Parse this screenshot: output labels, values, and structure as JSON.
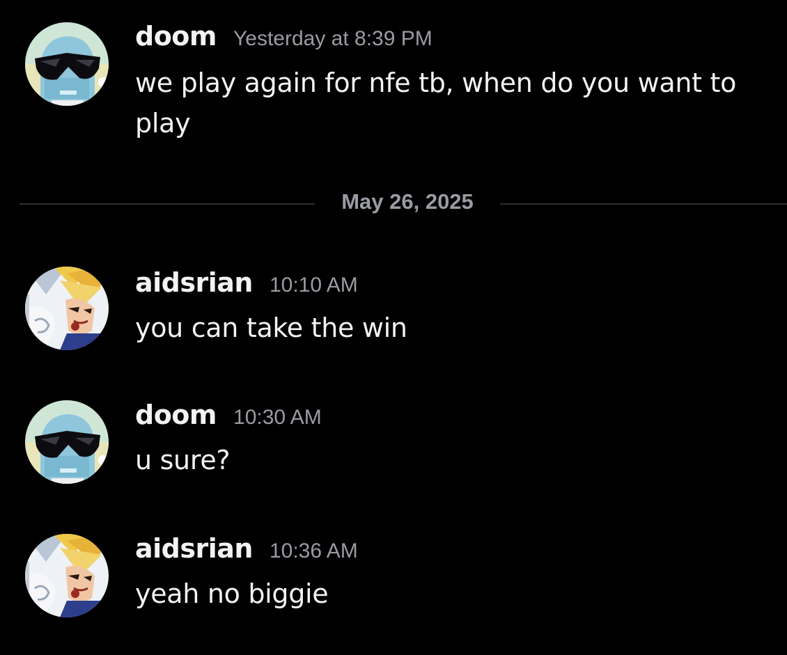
{
  "date_divider": "May 26, 2025",
  "messages": [
    {
      "author": "doom",
      "timestamp": "Yesterday at 8:39 PM",
      "text": "we play again for nfe tb, when do you want to play",
      "avatar": "squirtle-sunglasses-avatar"
    },
    {
      "author": "aidsrian",
      "timestamp": "10:10 AM",
      "text": "you can take the win",
      "avatar": "anime-character-avatar"
    },
    {
      "author": "doom",
      "timestamp": "10:30 AM",
      "text": "u sure?",
      "avatar": "squirtle-sunglasses-avatar"
    },
    {
      "author": "aidsrian",
      "timestamp": "10:36 AM",
      "text": "yeah no biggie",
      "avatar": "anime-character-avatar"
    }
  ],
  "colors": {
    "background": "#000000",
    "text": "#f2f3f5",
    "muted": "#9a9ca3",
    "divider": "#2b2d31"
  }
}
